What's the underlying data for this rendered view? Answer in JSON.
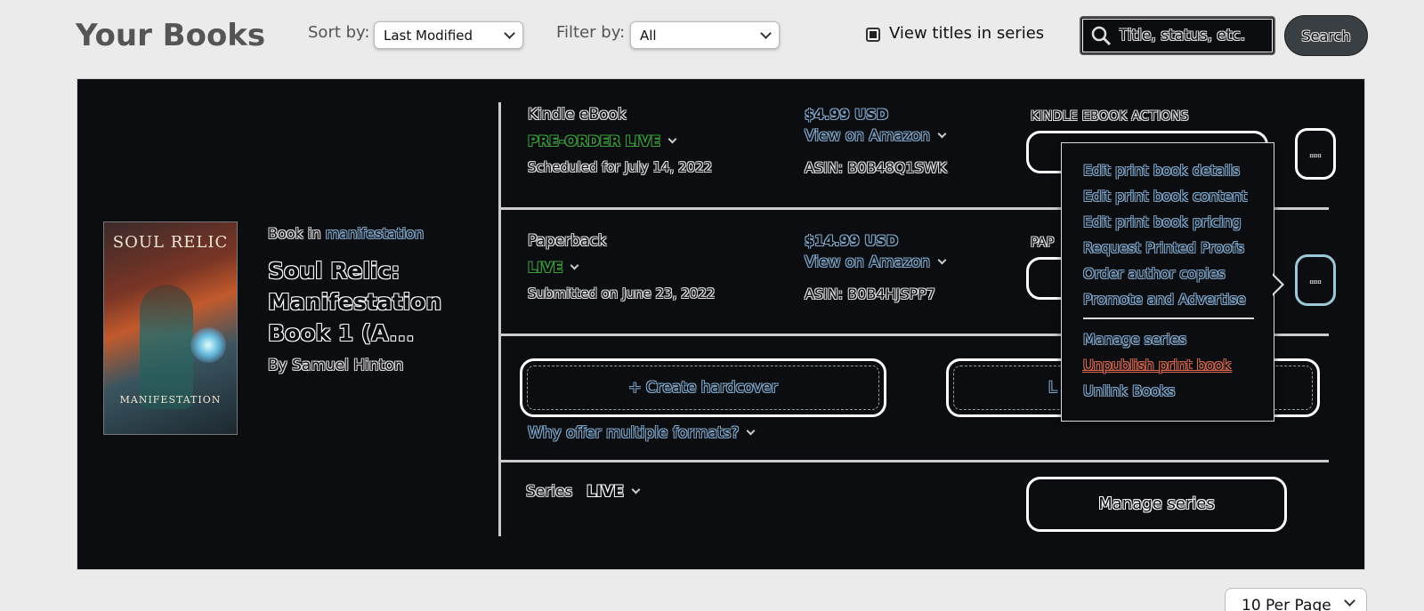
{
  "header": {
    "title": "Your Books",
    "sort_label": "Sort by:",
    "sort_value": "Last Modified",
    "filter_label": "Filter by:",
    "filter_value": "All",
    "series_checkbox_label": "View titles in series",
    "search_placeholder": "Title, status, etc.",
    "search_button": "Search"
  },
  "book": {
    "cover_title": "SOUL RELIC",
    "cover_subtitle": "MANIFESTATION",
    "book_in_prefix": "Book in ",
    "series_link": "manifestation",
    "title": "Soul Relic: Manifestation Book 1 (A...",
    "author": "By Samuel Hinton"
  },
  "formats": [
    {
      "name": "Kindle eBook",
      "status": "PRE-ORDER LIVE",
      "date": "Scheduled for July 14, 2022",
      "price": "$4.99 USD",
      "view_link": "View on Amazon",
      "asin": "ASIN: B0B48Q1SWK",
      "actions_label": "KINDLE EBOOK ACTIONS",
      "more": "..."
    },
    {
      "name": "Paperback",
      "status": "LIVE",
      "date": "Submitted on June 23, 2022",
      "price": "$14.99 USD",
      "view_link": "View on Amazon",
      "asin": "ASIN: B0B4HJSPP7",
      "actions_label": "PAP",
      "more": "..."
    }
  ],
  "create": {
    "hardcover": "+ Create hardcover",
    "second_partial": "L",
    "why_link": "Why offer multiple formats?"
  },
  "series_row": {
    "label": "Series",
    "status": "LIVE",
    "manage_button": "Manage series"
  },
  "menu": {
    "items": [
      "Edit print book details",
      "Edit print book content",
      "Edit print book pricing",
      "Request Printed Proofs",
      "Order author copies",
      "Promote and Advertise"
    ],
    "manage_series": "Manage series",
    "unpublish": "Unpublish print book",
    "unlink": "Unlink Books"
  },
  "pagination": {
    "per_page": "10 Per Page"
  },
  "colors": {
    "card_bg": "#0b0d10",
    "link_outline": "#7fa6c9",
    "live_green": "#3aa13a",
    "danger": "#d9684f"
  }
}
